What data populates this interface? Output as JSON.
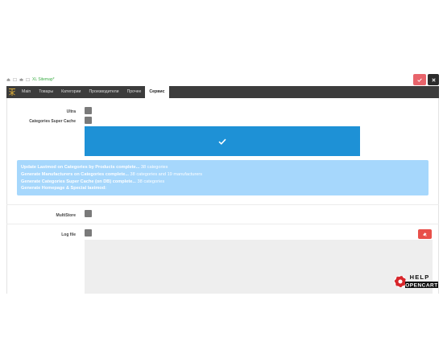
{
  "breadcrumb": {
    "items": [
      "",
      "",
      "",
      "",
      "XL Sitemap*"
    ]
  },
  "header": {
    "save_icon": "check-icon",
    "close_icon": "close-icon",
    "save_color": "#e8646b",
    "close_color": "#2c2c2c"
  },
  "tabs": [
    {
      "label": "Main"
    },
    {
      "label": "Товары"
    },
    {
      "label": "Категории"
    },
    {
      "label": "Производители"
    },
    {
      "label": "Прочее"
    },
    {
      "label": "Сервис"
    }
  ],
  "form": {
    "ultra_label": "Ultra",
    "supercache_label": "Categories Super Cache",
    "multistore_label": "MultiStore",
    "logfile_label": "Log file",
    "run_button_color": "#1e91d6"
  },
  "info": {
    "lines": [
      {
        "bold": "Update Lastmod on Categories by Products complete...",
        "rest": " 38 categories"
      },
      {
        "bold": "Generate Manufacturers on Categories complete...",
        "rest": " 38 categories and 19 manufacturers"
      },
      {
        "bold": "Generate Categories Super Cache (on DB) complete...",
        "rest": " 38 categories"
      },
      {
        "bold": "Generate Homepage & Special lastmod:",
        "rest": ""
      }
    ]
  },
  "watermark": {
    "top": "HELP",
    "bottom": "OPENCART"
  }
}
